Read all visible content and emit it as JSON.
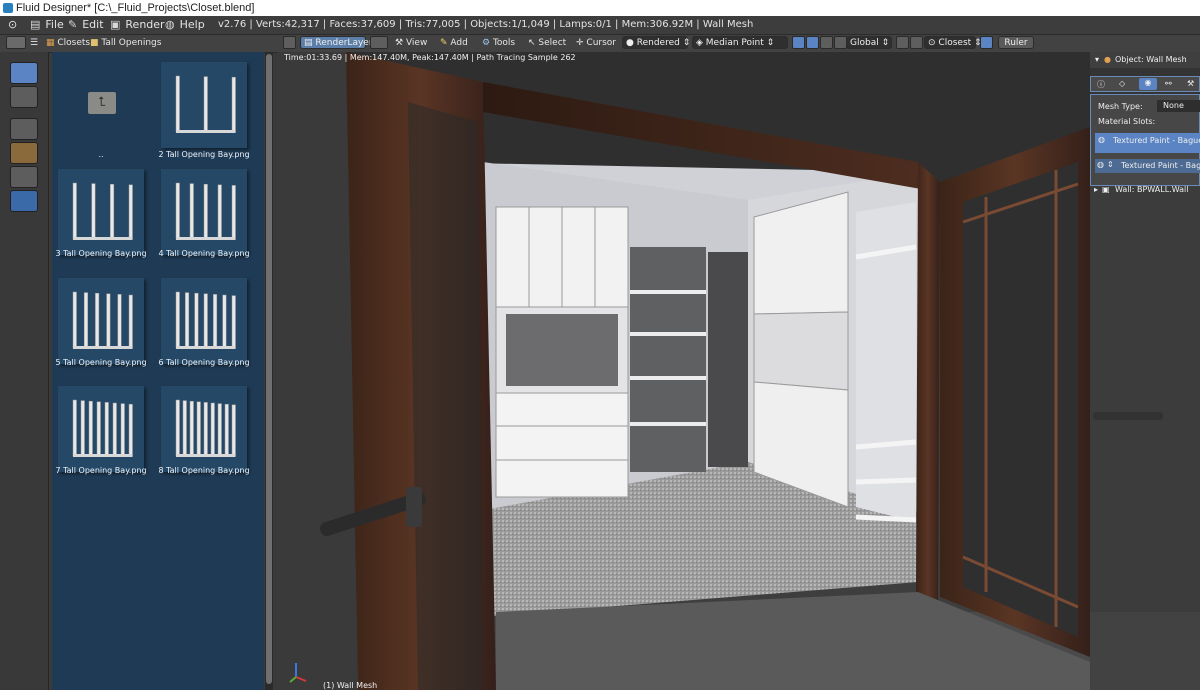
{
  "window": {
    "title": "Fluid Designer* [C:\\_Fluid_Projects\\Closet.blend]"
  },
  "menubar": {
    "items": [
      {
        "label": "File",
        "icon": "document-icon"
      },
      {
        "label": "Edit",
        "icon": "edit-icon"
      },
      {
        "label": "Render",
        "icon": "camera-icon"
      },
      {
        "label": "Help",
        "icon": "help-icon"
      }
    ],
    "stats": "v2.76 | Verts:42,317 | Faces:37,609 | Tris:77,005 | Objects:1/1,049 | Lamps:0/1 | Mem:306.92M | Wall Mesh"
  },
  "browser_header": {
    "breadcrumb": [
      "Closets",
      "Tall Openings"
    ]
  },
  "viewport_header": {
    "render_layer": "RenderLayer",
    "menus": [
      "View",
      "Add",
      "Tools",
      "Select",
      "Cursor"
    ],
    "shading": "Rendered",
    "pivot": "Median Point",
    "orientation": "Global",
    "snap": "Closest",
    "ruler": "Ruler"
  },
  "file_browser": {
    "items": [
      {
        "label": "..",
        "type": "parent-folder",
        "bays": 0
      },
      {
        "label": "2 Tall Opening Bay.png",
        "bays": 2
      },
      {
        "label": "3 Tall Opening Bay.png",
        "bays": 3
      },
      {
        "label": "4 Tall Opening Bay.png",
        "bays": 4
      },
      {
        "label": "5 Tall Opening Bay.png",
        "bays": 5
      },
      {
        "label": "6 Tall Opening Bay.png",
        "bays": 6
      },
      {
        "label": "7 Tall Opening Bay.png",
        "bays": 7
      },
      {
        "label": "8 Tall Opening Bay.png",
        "bays": 8
      }
    ]
  },
  "viewport": {
    "render_info": "Time:01:33.69 | Mem:147.40M, Peak:147.40M | Path Tracing Sample 262",
    "object_label": "(1) Wall Mesh"
  },
  "properties": {
    "header": "Object: Wall Mesh",
    "mesh_type_label": "Mesh Type:",
    "mesh_type_value": "None",
    "material_slots_label": "Material Slots:",
    "slot_1": "Textured Paint - Baguette",
    "slot_2": "Textured Paint - Baguette",
    "child": "Wall: BPWALL.Wall"
  },
  "colors": {
    "browser_bg": "#1f3a55",
    "accent": "#5a84c4"
  }
}
